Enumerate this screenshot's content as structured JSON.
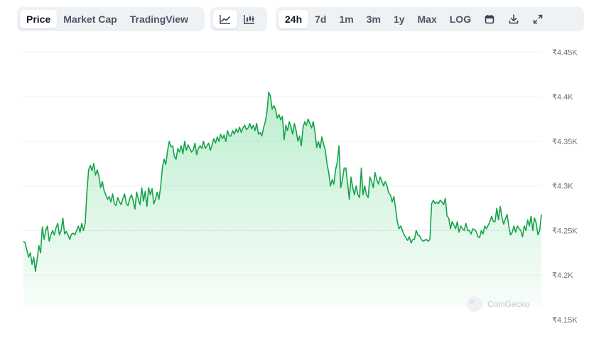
{
  "toolbar": {
    "view_tabs": [
      "Price",
      "Market Cap",
      "TradingView"
    ],
    "chart_type_icons": [
      "line-chart-icon",
      "candlestick-chart-icon"
    ],
    "ranges": [
      "24h",
      "7d",
      "1m",
      "3m",
      "1y",
      "Max",
      "LOG"
    ],
    "active_view": "Price",
    "active_range": "24h",
    "tool_icons": [
      "calendar-icon",
      "download-icon",
      "expand-icon"
    ]
  },
  "watermark": "CoinGecko",
  "colors": {
    "line": "#16a34a",
    "fill": "#22c55e",
    "grid": "#eef0f3",
    "active_tab_bg": "#ffffff",
    "toolbar_bg": "#eff2f5"
  },
  "chart_data": {
    "type": "area",
    "currency_symbol": "₹",
    "ylim": [
      4150,
      4475
    ],
    "y_ticks": [
      4150,
      4200,
      4250,
      4300,
      4350,
      4400,
      4450
    ],
    "y_tick_labels": [
      "₹4.15K",
      "₹4.2K",
      "₹4.25K",
      "₹4.3K",
      "₹4.35K",
      "₹4.4K",
      "₹4.45K"
    ],
    "grid": true,
    "x_axis_labels_shown": false,
    "series": [
      {
        "values": [
          4238,
          4236,
          4228,
          4220,
          4225,
          4212,
          4220,
          4204,
          4218,
          4233,
          4225,
          4254,
          4240,
          4250,
          4255,
          4238,
          4245,
          4250,
          4245,
          4253,
          4258,
          4245,
          4250,
          4264,
          4246,
          4249,
          4245,
          4240,
          4246,
          4247,
          4245,
          4250,
          4255,
          4248,
          4258,
          4250,
          4258,
          4293,
          4318,
          4323,
          4317,
          4325,
          4312,
          4318,
          4311,
          4298,
          4305,
          4295,
          4290,
          4285,
          4288,
          4282,
          4291,
          4280,
          4278,
          4287,
          4282,
          4279,
          4286,
          4291,
          4280,
          4278,
          4286,
          4290,
          4283,
          4274,
          4293,
          4285,
          4279,
          4298,
          4283,
          4294,
          4277,
          4298,
          4290,
          4297,
          4280,
          4285,
          4293,
          4285,
          4299,
          4320,
          4330,
          4324,
          4339,
          4350,
          4344,
          4345,
          4333,
          4330,
          4342,
          4338,
          4345,
          4336,
          4350,
          4340,
          4346,
          4342,
          4338,
          4340,
          4348,
          4335,
          4342,
          4345,
          4342,
          4350,
          4342,
          4345,
          4348,
          4340,
          4346,
          4353,
          4348,
          4355,
          4350,
          4358,
          4353,
          4357,
          4350,
          4362,
          4356,
          4356,
          4362,
          4358,
          4364,
          4360,
          4366,
          4360,
          4365,
          4368,
          4363,
          4365,
          4370,
          4364,
          4368,
          4362,
          4370,
          4358,
          4360,
          4356,
          4365,
          4372,
          4383,
          4405,
          4401,
          4386,
          4390,
          4386,
          4376,
          4380,
          4374,
          4378,
          4352,
          4368,
          4362,
          4372,
          4366,
          4358,
          4370,
          4362,
          4350,
          4356,
          4345,
          4365,
          4372,
          4368,
          4375,
          4370,
          4365,
          4372,
          4360,
          4343,
          4350,
          4342,
          4355,
          4347,
          4340,
          4325,
          4315,
          4300,
          4307,
          4302,
          4318,
          4327,
          4345,
          4298,
          4307,
          4320,
          4320,
          4303,
          4285,
          4310,
          4298,
          4290,
          4300,
          4290,
          4287,
          4320,
          4290,
          4300,
          4290,
          4287,
          4310,
          4305,
          4298,
          4315,
          4307,
          4302,
          4310,
          4305,
          4300,
          4305,
          4300,
          4292,
          4290,
          4282,
          4288,
          4275,
          4260,
          4252,
          4255,
          4250,
          4245,
          4242,
          4239,
          4243,
          4236,
          4240,
          4240,
          4250,
          4245,
          4244,
          4240,
          4238,
          4239,
          4240,
          4238,
          4240,
          4280,
          4284,
          4280,
          4282,
          4280,
          4284,
          4282,
          4279,
          4286,
          4266,
          4264,
          4252,
          4260,
          4256,
          4252,
          4260,
          4248,
          4255,
          4252,
          4250,
          4258,
          4250,
          4250,
          4246,
          4252,
          4251,
          4249,
          4243,
          4242,
          4250,
          4246,
          4255,
          4252,
          4256,
          4260,
          4266,
          4260,
          4260,
          4275,
          4262,
          4277,
          4265,
          4257,
          4263,
          4268,
          4255,
          4245,
          4248,
          4255,
          4248,
          4255,
          4252,
          4250,
          4243,
          4255,
          4250,
          4262,
          4255,
          4266,
          4250,
          4264,
          4258,
          4245,
          4250,
          4268
        ]
      }
    ]
  }
}
